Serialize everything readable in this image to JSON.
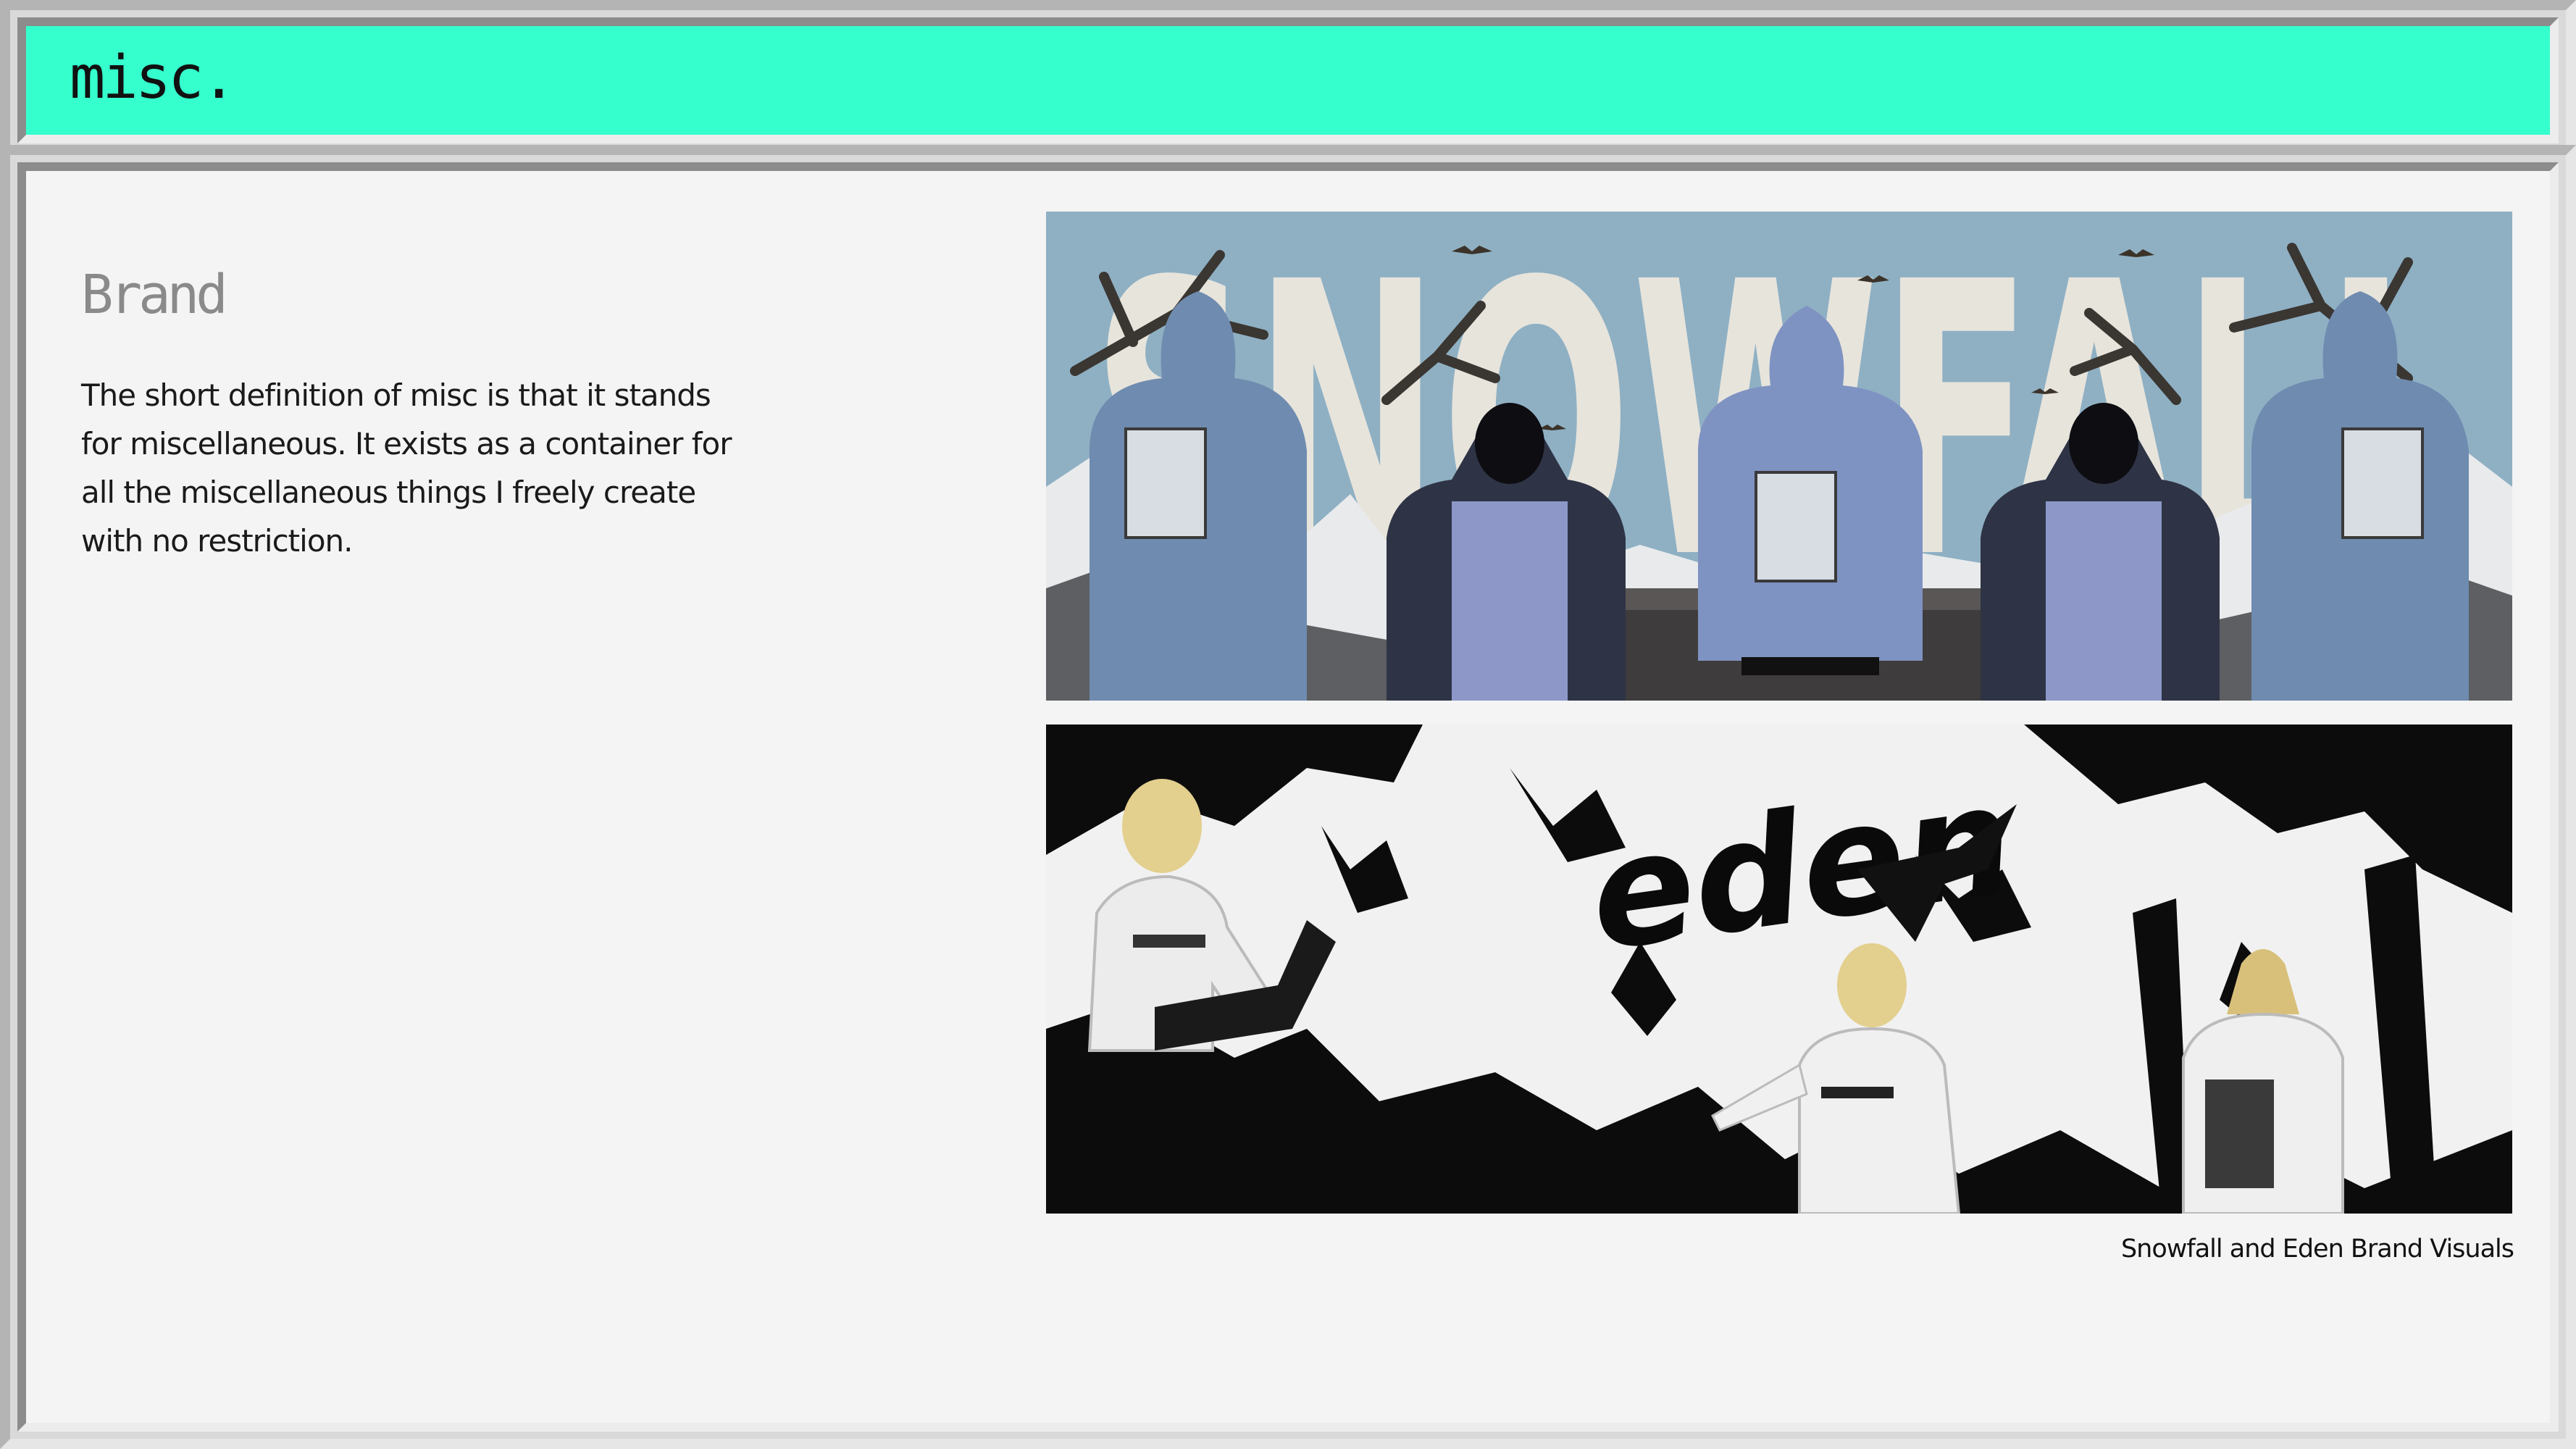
{
  "window": {
    "title": "misc."
  },
  "content": {
    "heading": "Brand",
    "description": "The short definition of misc is that it stands for miscellaneous. It exists as a container for all the miscellaneous things I freely create with no restriction.",
    "caption": "Snowfall and Eden Brand Visuals"
  },
  "visuals": {
    "snowfall_word": "SNOWFALL",
    "eden_word": "eden"
  },
  "colors": {
    "title_bar": "#35ffcd",
    "panel": "#f4f4f4",
    "sky": "#8fb0c3",
    "hoodie": "#7f93c2"
  }
}
